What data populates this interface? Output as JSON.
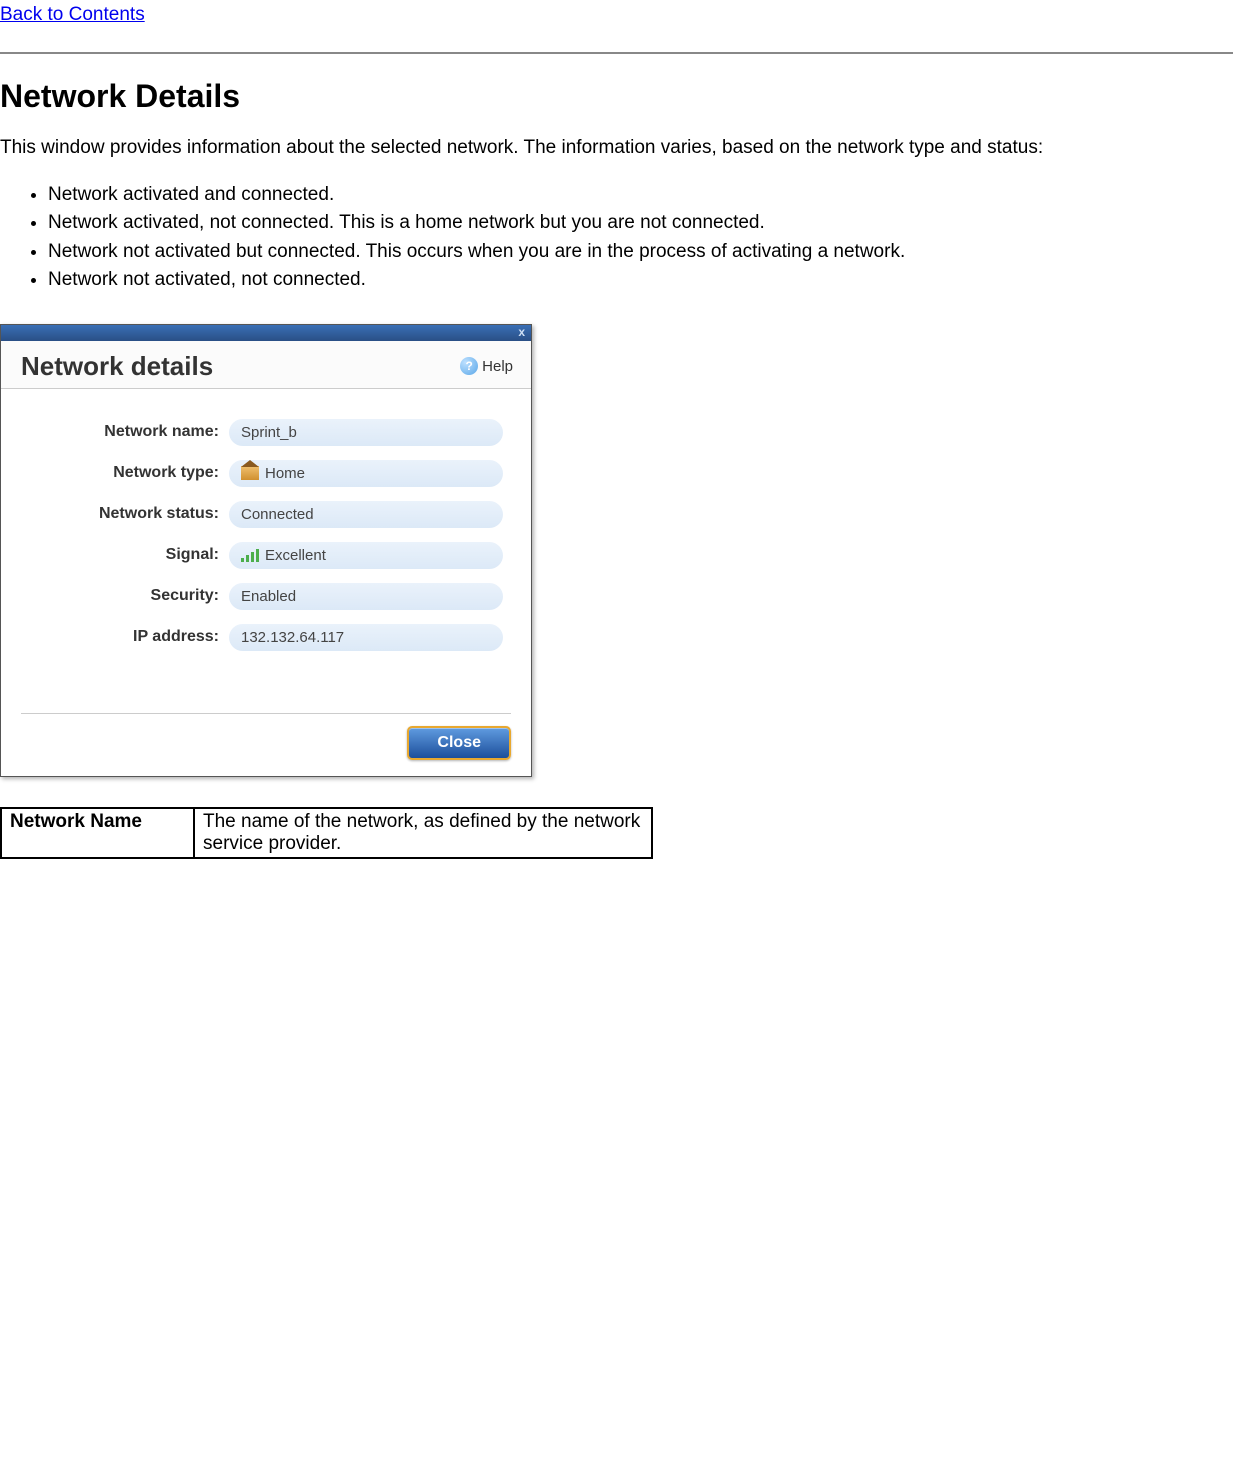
{
  "nav": {
    "back_link": "Back to Contents"
  },
  "page": {
    "heading": "Network Details",
    "intro": "This window provides information about the selected network. The information varies, based on the network type and status:",
    "states": [
      "Network activated and connected.",
      "Network activated, not connected. This is a home network but you are not connected.",
      "Network not activated but connected. This occurs when you are in the process of activating a network.",
      "Network not activated, not connected."
    ]
  },
  "dialog": {
    "title": "Network details",
    "help_label": "Help",
    "close_x": "x",
    "close_button": "Close",
    "fields": {
      "network_name": {
        "label": "Network name:",
        "value": "Sprint_b"
      },
      "network_type": {
        "label": "Network type:",
        "value": "Home"
      },
      "network_status": {
        "label": "Network status:",
        "value": "Connected"
      },
      "signal": {
        "label": "Signal:",
        "value": "Excellent"
      },
      "security": {
        "label": "Security:",
        "value": "Enabled"
      },
      "ip_address": {
        "label": "IP address:",
        "value": "132.132.64.117"
      }
    }
  },
  "table": {
    "row1": {
      "name": "Network Name",
      "desc": "The name of the network, as defined by the network service provider."
    }
  }
}
